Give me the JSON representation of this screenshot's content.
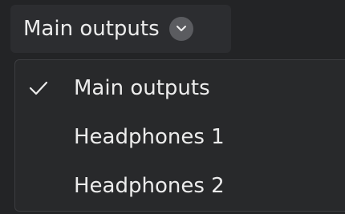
{
  "selector": {
    "label": "Main outputs",
    "icon": "chevron-down-icon"
  },
  "dropdown": {
    "selected_index": 0,
    "items": [
      {
        "label": "Main outputs",
        "selected": true
      },
      {
        "label": "Headphones 1",
        "selected": false
      },
      {
        "label": "Headphones 2",
        "selected": false
      }
    ]
  },
  "colors": {
    "background": "#232426",
    "button_background": "#2c2d30",
    "menu_background": "#28292b",
    "text": "#ececec",
    "chevron_circle": "#5b5c60"
  }
}
